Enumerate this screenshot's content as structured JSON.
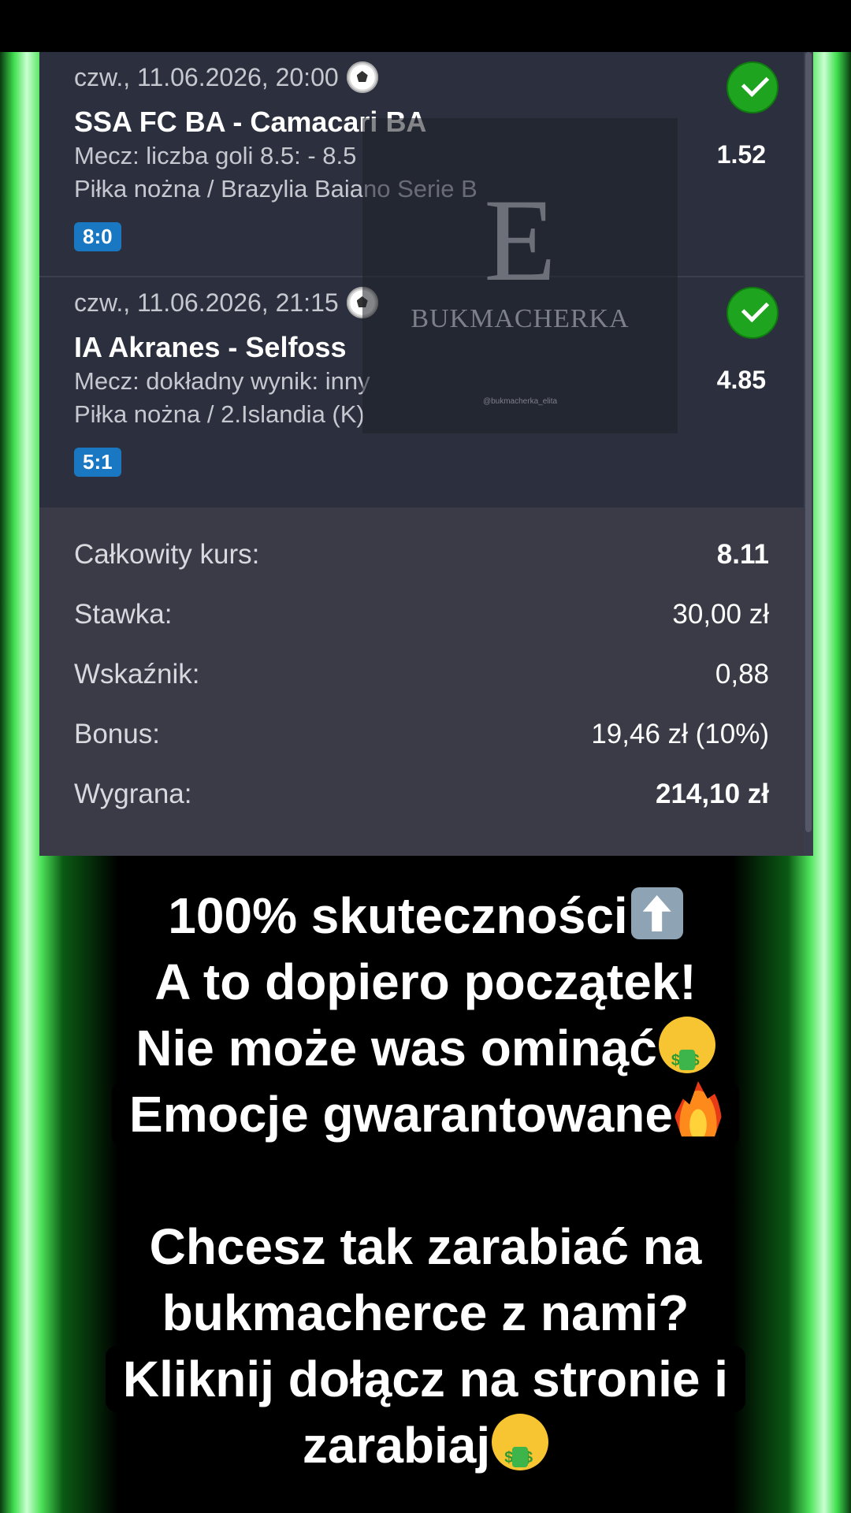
{
  "slip": {
    "events": [
      {
        "date": "czw., 11.06.2026, 20:00",
        "teams": "SSA FC BA - Camacari BA",
        "market": "Mecz: liczba goli 8.5: - 8.5",
        "league": "Piłka nożna / Brazylia Baiano Serie B",
        "odds": "1.52",
        "score": "8:0",
        "status": "won"
      },
      {
        "date": "czw., 11.06.2026, 21:15",
        "teams": "IA Akranes - Selfoss",
        "market": "Mecz: dokładny wynik: inny",
        "league": "Piłka nożna / 2.Islandia (K)",
        "odds": "4.85",
        "score": "5:1",
        "status": "won"
      }
    ],
    "summary": {
      "total_odds_label": "Całkowity kurs:",
      "total_odds_value": "8.11",
      "stake_label": "Stawka:",
      "stake_value": "30,00 zł",
      "ratio_label": "Wskaźnik:",
      "ratio_value": "0,88",
      "bonus_label": "Bonus:",
      "bonus_value": "19,46 zł (10%)",
      "win_label": "Wygrana:",
      "win_value": "214,10 zł"
    }
  },
  "watermark": {
    "letter": "E",
    "name": "BUKMACHERKA",
    "handle": "@bukmacherka_elita"
  },
  "promo": {
    "line1": "100% skuteczności",
    "line2": "A to dopiero początek!",
    "line3": "Nie może was ominąć",
    "line4": "Emocje gwarantowane",
    "line5": "Chcesz tak zarabiać na",
    "line6": "bukmacherce z nami?",
    "line7": "Kliknij dołącz na stronie i",
    "line8": "zarabiaj"
  },
  "colors": {
    "glow": "#4ee35a",
    "card": "#2c2f3d",
    "summary": "#3a3b47",
    "badge": "#1a78c2",
    "check": "#1fa41f"
  }
}
